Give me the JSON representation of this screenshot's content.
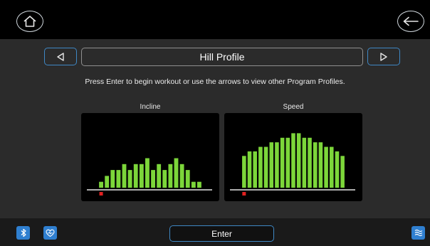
{
  "header": {
    "home_icon": "home-icon",
    "back_icon": "back-arrow-icon"
  },
  "program": {
    "title": "Hill Profile",
    "prev_icon": "triangle-left-icon",
    "next_icon": "triangle-right-icon",
    "instructions": "Press Enter to begin workout or use the arrows to view other Program Profiles."
  },
  "chart_data": [
    {
      "type": "bar",
      "title": "Incline",
      "values": [
        1,
        2,
        3,
        3,
        4,
        3,
        4,
        4,
        5,
        3,
        4,
        3,
        4,
        5,
        4,
        3,
        1,
        1
      ],
      "ylim": [
        0,
        10
      ],
      "bar_color": "#7cd63a",
      "position_marker_index": 0,
      "marker_color": "#e02020"
    },
    {
      "type": "bar",
      "title": "Speed",
      "values": [
        7,
        8,
        8,
        9,
        9,
        10,
        10,
        11,
        11,
        12,
        12,
        11,
        11,
        10,
        10,
        9,
        9,
        8,
        7
      ],
      "ylim": [
        0,
        13
      ],
      "bar_color": "#7cd63a",
      "position_marker_index": 0,
      "marker_color": "#e02020"
    }
  ],
  "footer": {
    "enter_label": "Enter",
    "bluetooth_icon": "bluetooth-icon",
    "heart_icon": "heart-rate-icon",
    "fan_icon": "fan-icon",
    "accent_color": "#2f7fd0"
  }
}
